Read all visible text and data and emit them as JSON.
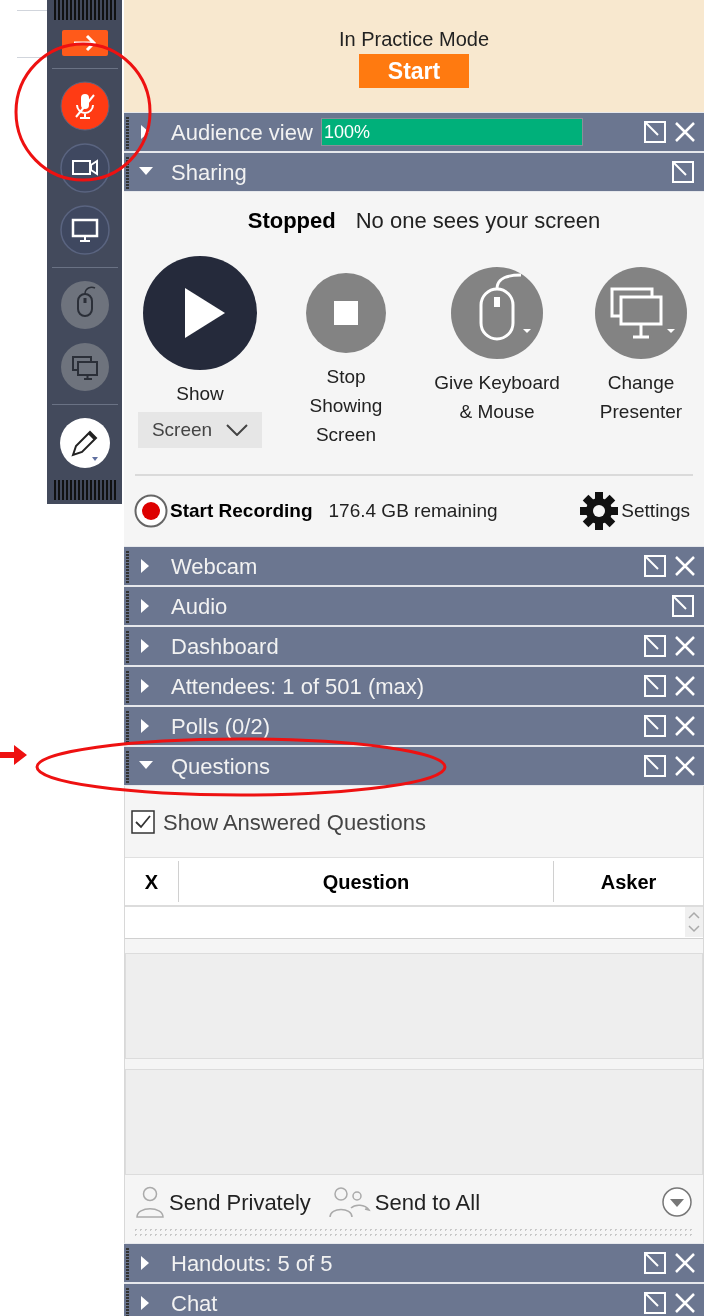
{
  "toolbar": {
    "buttons": [
      {
        "kind": "exit"
      },
      {
        "kind": "mic",
        "muted": true
      },
      {
        "kind": "webcam"
      },
      {
        "kind": "screen"
      },
      {
        "kind": "mouse",
        "disabled": true
      },
      {
        "kind": "presenter",
        "disabled": true
      },
      {
        "kind": "draw"
      }
    ]
  },
  "banner": {
    "mode": "In Practice Mode",
    "start_button": "Start"
  },
  "panes": [
    {
      "kind": "audience",
      "title": "Audience view",
      "expanded": false,
      "closable": true,
      "meter": {
        "level": 1,
        "reading": "100%"
      }
    },
    {
      "kind": "sharing",
      "title": "Sharing",
      "expanded": true,
      "closable": false
    },
    {
      "kind": "plain",
      "title": "Webcam",
      "expanded": false,
      "closable": true
    },
    {
      "kind": "plain",
      "title": "Audio",
      "expanded": false,
      "closable": false
    },
    {
      "kind": "plain",
      "title": "Dashboard",
      "expanded": false,
      "closable": true
    },
    {
      "kind": "plain",
      "title": "Attendees:  1 of 501 (max)",
      "expanded": false,
      "closable": true
    },
    {
      "kind": "plain",
      "title": "Polls (0/2)",
      "expanded": false,
      "closable": true
    },
    {
      "kind": "questions",
      "title": "Questions",
      "expanded": true,
      "closable": true
    },
    {
      "kind": "plain",
      "title": "Handouts: 5 of 5",
      "expanded": false,
      "closable": true
    },
    {
      "kind": "plain",
      "title": "Chat",
      "expanded": false,
      "closable": true
    }
  ],
  "sharing": {
    "status": "Stopped",
    "message": "No one sees your screen",
    "actions": [
      {
        "kind": "show",
        "label": "Show",
        "dropdown": "Screen"
      },
      {
        "kind": "stop",
        "label": "Stop Showing Screen"
      },
      {
        "kind": "mouse",
        "label": "Give Keyboard & Mouse"
      },
      {
        "kind": "presenter",
        "label": "Change Presenter"
      }
    ],
    "recording": {
      "label": "Start Recording",
      "remaining": "176.4 GB remaining",
      "settings": "Settings"
    }
  },
  "questions": {
    "show_answered": {
      "label": "Show Answered Questions",
      "checked": true
    },
    "columns": [
      "X",
      "Question",
      "Asker"
    ],
    "send_buttons": [
      {
        "kind": "private",
        "label": "Send Privately"
      },
      {
        "kind": "all",
        "label": "Send to All"
      }
    ]
  }
}
